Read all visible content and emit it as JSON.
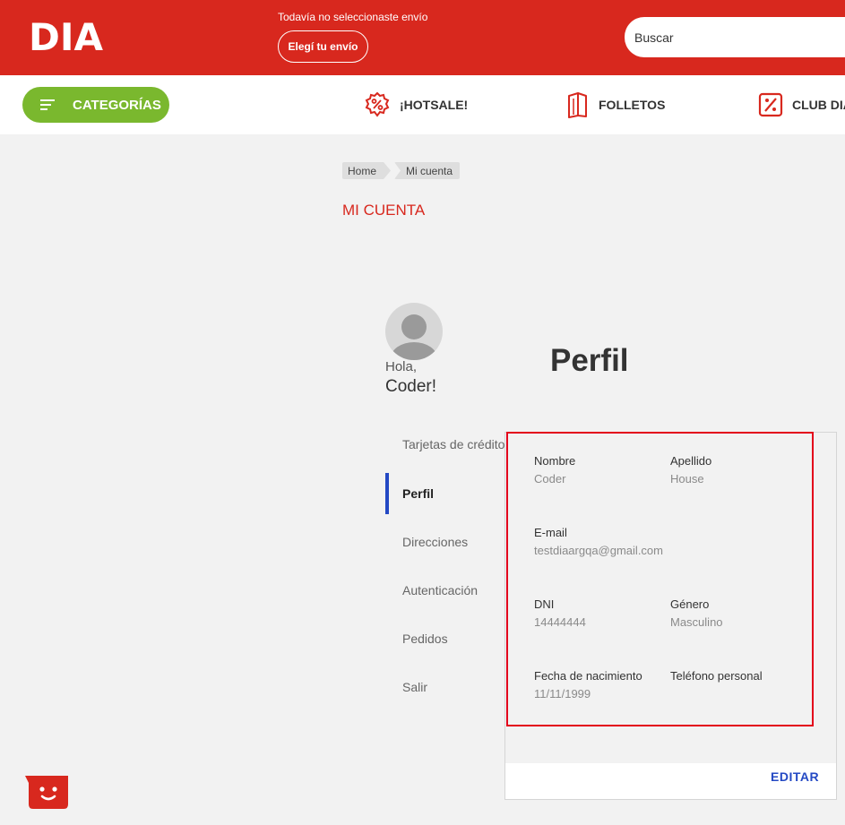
{
  "header": {
    "logo_text": "DIA",
    "shipping_status": "Todavía no seleccionaste envío",
    "shipping_button": "Elegí tu envío",
    "search_placeholder": "Buscar"
  },
  "nav": {
    "categories": "CATEGORÍAS",
    "hotsale": "¡HOTSALE!",
    "folletos": "FOLLETOS",
    "club": "CLUB DIA"
  },
  "breadcrumb": [
    "Home",
    "Mi cuenta"
  ],
  "page_title": "MI CUENTA",
  "user": {
    "greeting": "Hola,",
    "name": "Coder!"
  },
  "sidebar": {
    "items": [
      {
        "label": "Tarjetas de crédito"
      },
      {
        "label": "Perfil"
      },
      {
        "label": "Direcciones"
      },
      {
        "label": "Autenticación"
      },
      {
        "label": "Pedidos"
      },
      {
        "label": "Salir"
      }
    ]
  },
  "profile": {
    "title": "Perfil",
    "fields": {
      "nombre": {
        "label": "Nombre",
        "value": "Coder"
      },
      "apellido": {
        "label": "Apellido",
        "value": "House"
      },
      "email": {
        "label": "E-mail",
        "value": "testdiaargqa@gmail.com"
      },
      "dni": {
        "label": "DNI",
        "value": "14444444"
      },
      "genero": {
        "label": "Género",
        "value": "Masculino"
      },
      "nacimiento": {
        "label": "Fecha de nacimiento",
        "value": "11/11/1999"
      },
      "telefono": {
        "label": "Teléfono personal",
        "value": ""
      }
    },
    "edit": "EDITAR"
  },
  "colors": {
    "brand_red": "#d8281e",
    "accent_green": "#7ab82e",
    "link_blue": "#2449c4",
    "highlight_red": "#e3001b"
  },
  "icons": [
    "dia-logo",
    "menu-icon",
    "percent-icon",
    "folleto-icon",
    "club-icon",
    "avatar-icon",
    "chat-icon"
  ]
}
